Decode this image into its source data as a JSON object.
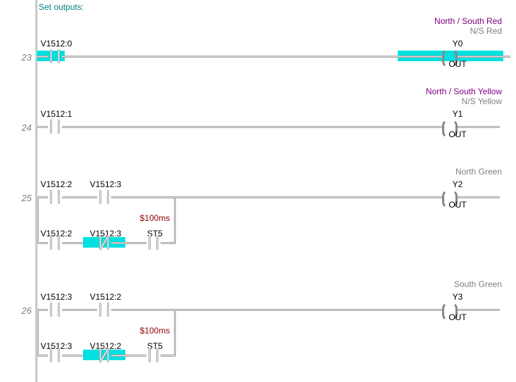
{
  "heading": "Set outputs:",
  "rungs": {
    "23": {
      "num": "23",
      "contacts": [
        {
          "addr": "V1512:0",
          "nc": false,
          "highlight": true
        }
      ],
      "coil": {
        "addr": "Y0",
        "type": "OUT",
        "long": "North / South Red",
        "alias": "N/S Red",
        "highlight": true
      }
    },
    "24": {
      "num": "24",
      "contacts": [
        {
          "addr": "V1512:1",
          "nc": false,
          "highlight": false
        }
      ],
      "coil": {
        "addr": "Y1",
        "type": "OUT",
        "long": "North / South Yellow",
        "alias": "N/S Yellow",
        "highlight": false
      }
    },
    "25": {
      "num": "25",
      "contacts_top": [
        {
          "addr": "V1512:2",
          "nc": false,
          "highlight": false
        },
        {
          "addr": "V1512:3",
          "nc": false,
          "highlight": false
        }
      ],
      "contacts_bot": [
        {
          "addr": "V1512:2",
          "nc": false,
          "highlight": false
        },
        {
          "addr": "V1512:3",
          "nc": true,
          "highlight": true
        },
        {
          "addr": "ST5",
          "nc": false,
          "highlight": false
        }
      ],
      "time": "$100ms",
      "coil": {
        "addr": "Y2",
        "type": "OUT",
        "long": "",
        "alias": "North Green",
        "highlight": false
      }
    },
    "26": {
      "num": "26",
      "contacts_top": [
        {
          "addr": "V1512:3",
          "nc": false,
          "highlight": false
        },
        {
          "addr": "V1512:2",
          "nc": false,
          "highlight": false
        }
      ],
      "contacts_bot": [
        {
          "addr": "V1512:3",
          "nc": false,
          "highlight": false
        },
        {
          "addr": "V1512:2",
          "nc": true,
          "highlight": true
        },
        {
          "addr": "ST5",
          "nc": false,
          "highlight": false
        }
      ],
      "time": "$100ms",
      "coil": {
        "addr": "Y3",
        "type": "OUT",
        "long": "",
        "alias": "South Green",
        "highlight": false
      }
    }
  }
}
